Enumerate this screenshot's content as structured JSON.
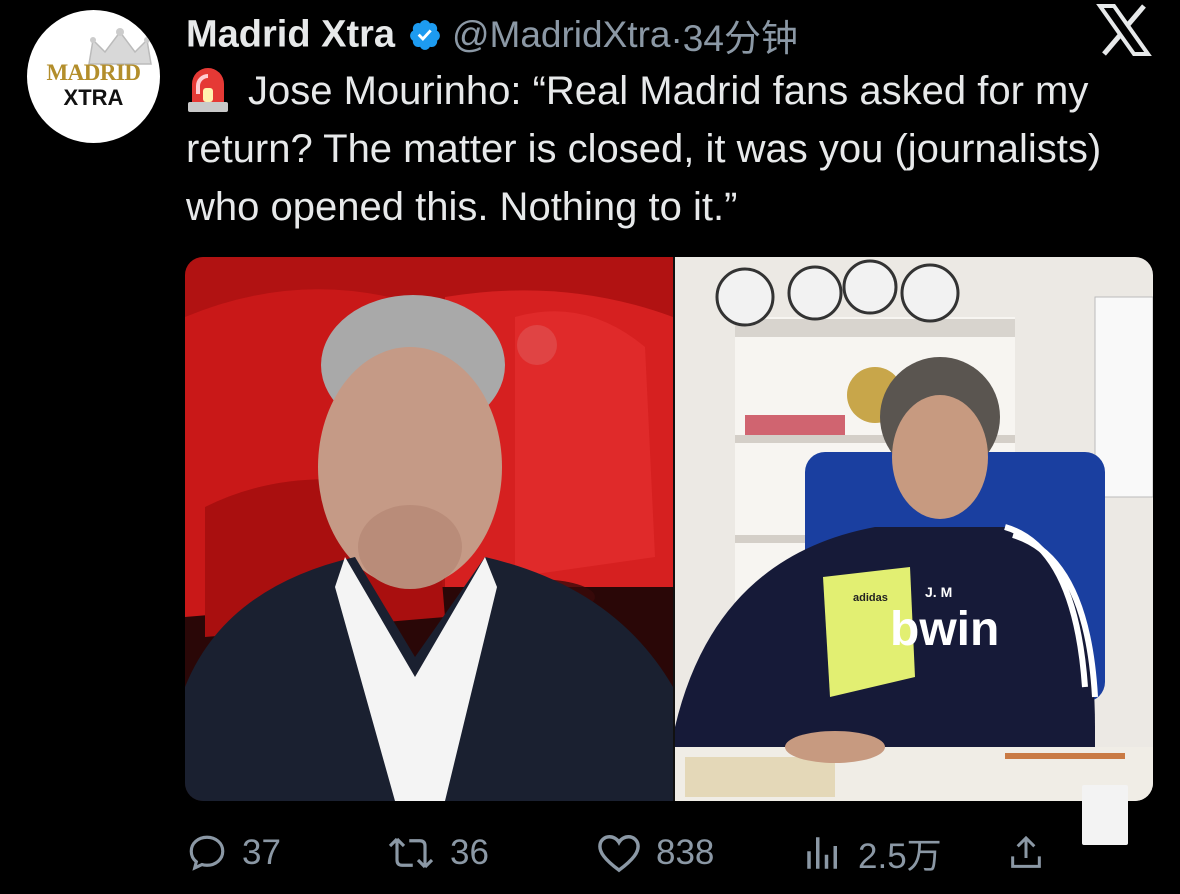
{
  "account": {
    "name": "Madrid Xtra",
    "handle": "@MadridXtra",
    "time": "·34分钟",
    "avatar_line1": "MADRID",
    "avatar_line2": "XTRA"
  },
  "tweet": {
    "text": "Jose Mourinho: “Real Madrid fans asked for my return? The matter is closed, it was you (journalists) who opened this. Nothing to it.”",
    "emoji": "siren-icon"
  },
  "media": {
    "left_jersey_text": "",
    "right_initials": "J. M",
    "right_sponsor": "bwin",
    "right_brand": "adidas"
  },
  "actions": {
    "replies": "37",
    "retweets": "36",
    "likes": "838",
    "views": "2.5万"
  },
  "colors": {
    "background": "#000000",
    "text": "#e7e9ea",
    "muted": "#8b98a5",
    "verified": "#1d9bf0",
    "avatar_gold": "#b38e2b"
  }
}
